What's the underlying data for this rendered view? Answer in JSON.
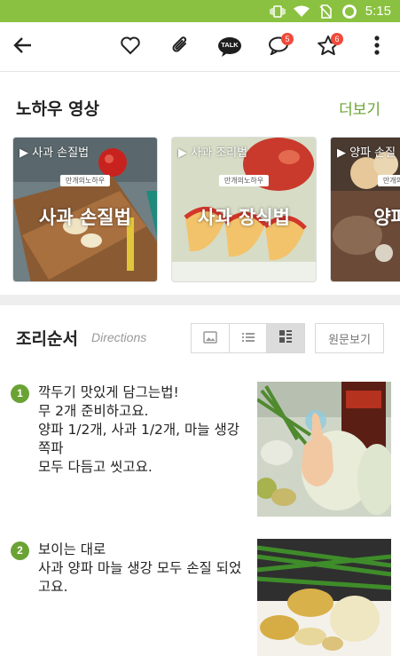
{
  "status_bar": {
    "time": "5:15"
  },
  "app_bar": {
    "comment_badge": "5",
    "star_badge": "6",
    "talk_label": "TALK"
  },
  "knowhow": {
    "title": "노하우 영상",
    "more": "더보기",
    "cards": [
      {
        "tag": "▶ 사과 손질법",
        "brand": "만개의노하우",
        "big": "사과 손질법"
      },
      {
        "tag": "▶ 사과 조리법",
        "brand": "만개의노하우",
        "big": "사과 장식법"
      },
      {
        "tag": "▶ 양파 손질",
        "brand": "만개의노하우",
        "big": "양파 손"
      }
    ]
  },
  "directions": {
    "title": "조리순서",
    "subtitle": "Directions",
    "original_button": "원문보기",
    "steps": [
      {
        "num": "1",
        "text": "깍두기 맛있게 담그는법!\n무 2개 준비하고요.\n양파 1/2개, 사과 1/2개, 마늘 생강 쪽파\n모두 다듬고 씻고요."
      },
      {
        "num": "2",
        "text": "보이는 대로\n사과 양파 마늘 생강 모두 손질 되었고요."
      }
    ]
  },
  "colors": {
    "accent": "#6aa334",
    "status_bar": "#8ac140",
    "badge": "#f04a3b"
  }
}
